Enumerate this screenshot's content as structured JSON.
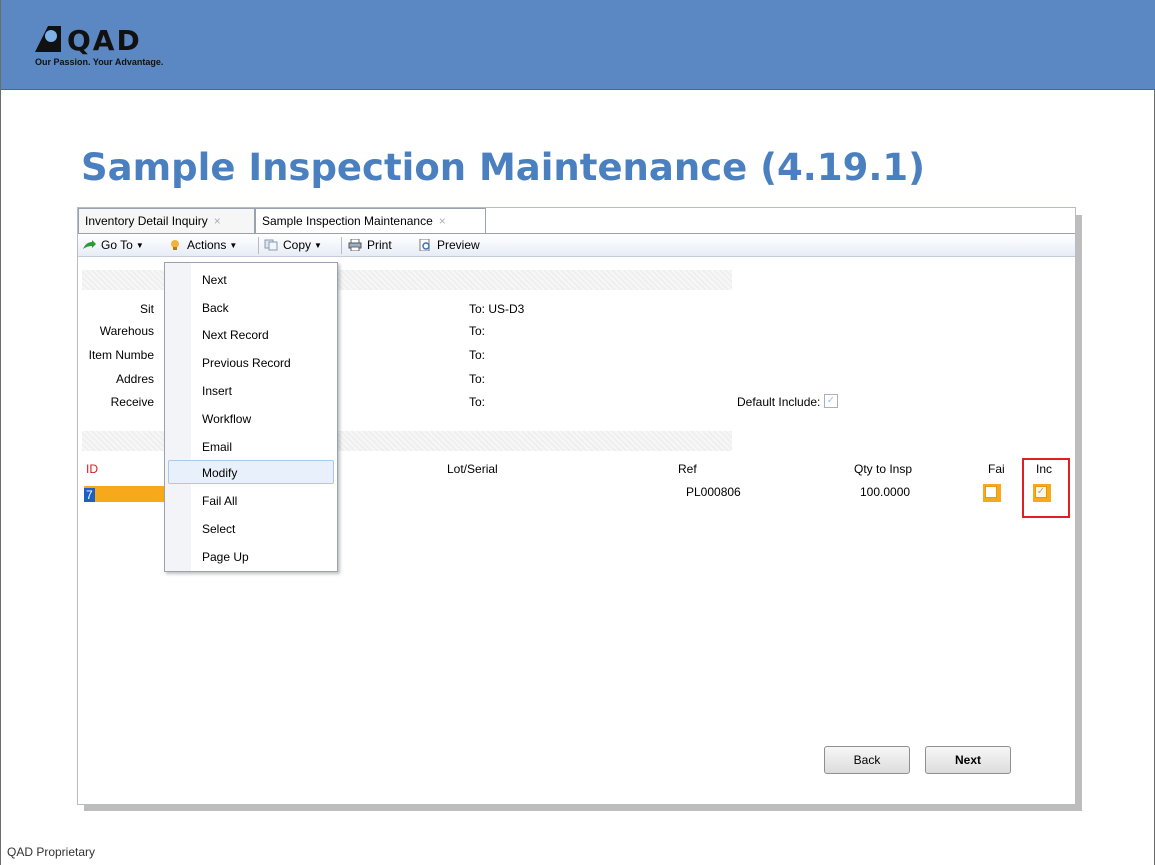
{
  "slide": {
    "logo_text": "QAD",
    "tagline": "Our Passion. Your Advantage.",
    "title": "Sample Inspection Maintenance (4.19.1)",
    "footer": "QAD Proprietary",
    "banner_color": "#5b88c3",
    "title_color": "#4a7fc0"
  },
  "tabs": [
    {
      "label": "Inventory Detail Inquiry",
      "close": "×"
    },
    {
      "label": "Sample Inspection Maintenance",
      "close": "×"
    }
  ],
  "toolbar": {
    "goto": "Go To",
    "actions": "Actions",
    "copy": "Copy",
    "print": "Print",
    "preview": "Preview"
  },
  "form": {
    "labels": [
      "Sit",
      "Warehous",
      "Item Numbe",
      "Addres",
      "Receive"
    ],
    "to_values": [
      "To: US-D3",
      "To:",
      "To:",
      "To:",
      "To:"
    ],
    "default_include": "Default Include:"
  },
  "grid": {
    "columns": {
      "id": "ID",
      "lot": "Lot/Serial",
      "ref": "Ref",
      "qty": "Qty to Insp",
      "fail": "Fai",
      "include": "Inc"
    },
    "row": {
      "id": "7",
      "ref": "PL000806",
      "qty": "100.0000",
      "fail": false,
      "include": true
    },
    "accent": "#f7a81b"
  },
  "buttons": {
    "back": "Back",
    "next": "Next"
  },
  "menu": {
    "items": [
      "Next",
      "Back",
      "Next Record",
      "Previous Record",
      "Insert",
      "Workflow",
      "Email",
      "Modify",
      "Fail All",
      "Select",
      "Page Up"
    ],
    "highlighted": "Modify"
  }
}
